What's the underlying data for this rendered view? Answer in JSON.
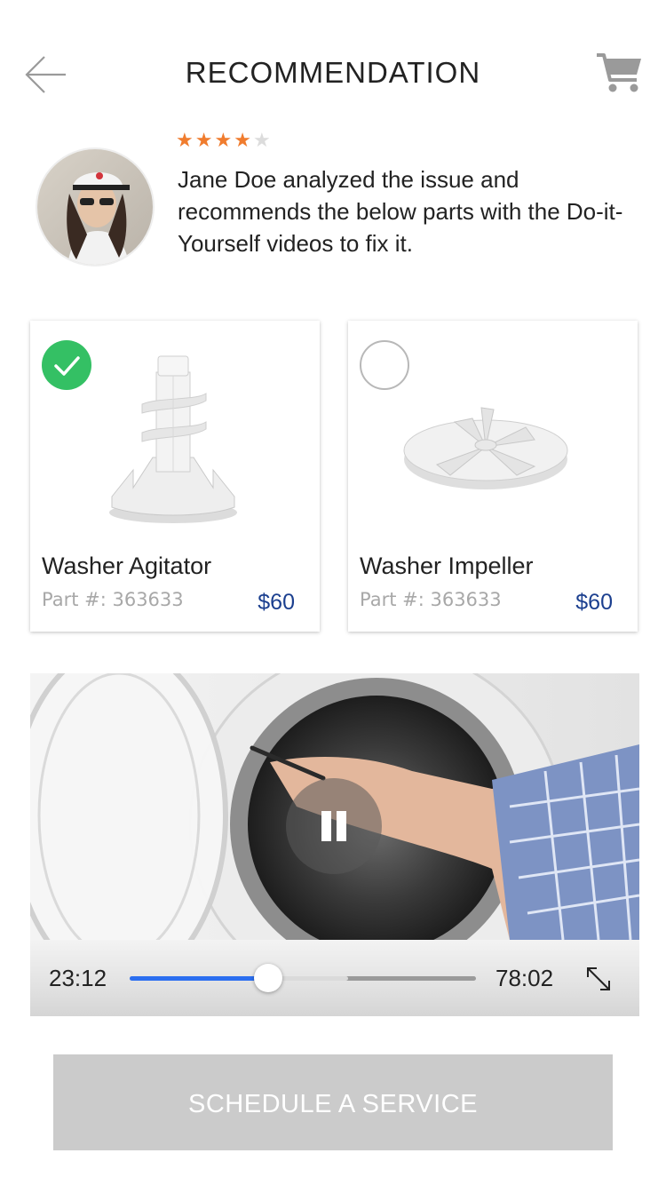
{
  "header": {
    "title": "RECOMMENDATION",
    "back_icon": "arrow-left-icon",
    "cart_icon": "cart-icon"
  },
  "expert": {
    "rating": 4,
    "rating_max": 5,
    "message": "Jane Doe analyzed the issue and recommends the below parts with the Do-it-Yourself videos to fix it."
  },
  "parts": [
    {
      "name": "Washer Agitator",
      "part_number": "Part #: 363633",
      "price": "$60",
      "selected": true
    },
    {
      "name": "Washer Impeller",
      "part_number": "Part #: 363633",
      "price": "$60",
      "selected": false
    }
  ],
  "video": {
    "current_time": "23:12",
    "duration": "78:02",
    "progress": 0.4,
    "buffered": 0.63
  },
  "cta": {
    "label": "SCHEDULE A SERVICE"
  },
  "colors": {
    "star": "#f07c2e",
    "check": "#34c064",
    "price": "#1b3f8f",
    "progress": "#2b6ef0",
    "cta_bg": "#cbcbcb"
  }
}
